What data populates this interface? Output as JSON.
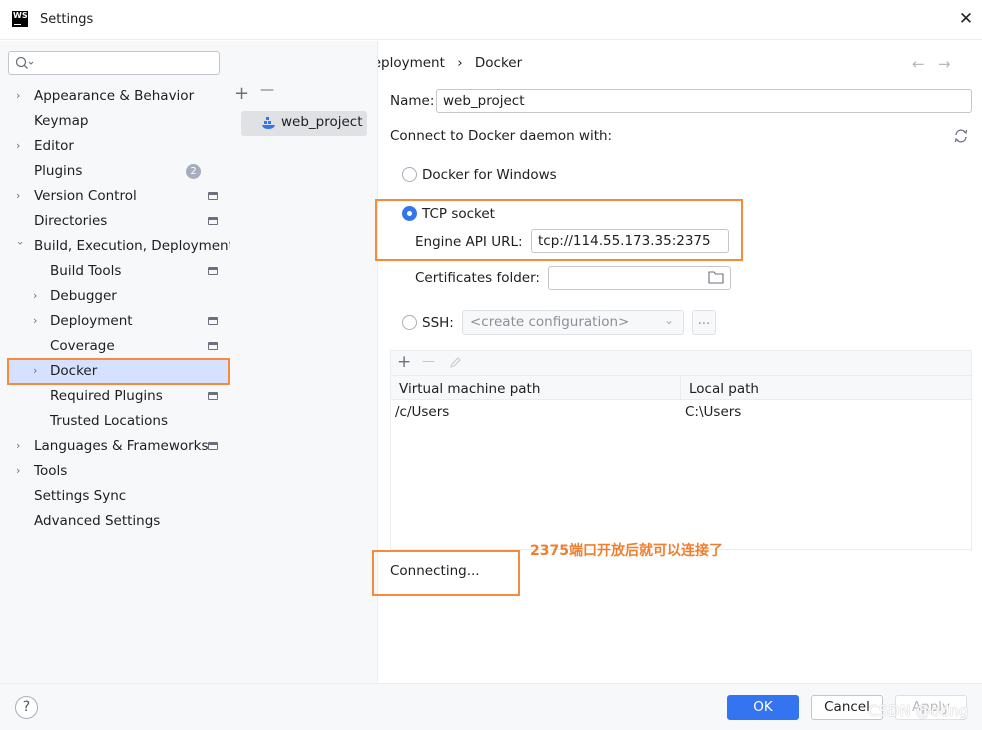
{
  "window": {
    "title": "Settings"
  },
  "search": {
    "placeholder": ""
  },
  "sidebar": {
    "items": [
      {
        "label": "Appearance & Behavior"
      },
      {
        "label": "Keymap"
      },
      {
        "label": "Editor"
      },
      {
        "label": "Plugins",
        "badge": "2"
      },
      {
        "label": "Version Control"
      },
      {
        "label": "Directories"
      },
      {
        "label": "Build, Execution, Deployment"
      },
      {
        "label": "Build Tools"
      },
      {
        "label": "Debugger"
      },
      {
        "label": "Deployment"
      },
      {
        "label": "Coverage"
      },
      {
        "label": "Docker"
      },
      {
        "label": "Required Plugins"
      },
      {
        "label": "Trusted Locations"
      },
      {
        "label": "Languages & Frameworks"
      },
      {
        "label": "Tools"
      },
      {
        "label": "Settings Sync"
      },
      {
        "label": "Advanced Settings"
      }
    ]
  },
  "breadcrumb": {
    "parent": "Build, Execution, Deployment",
    "separator": "›",
    "current": "Docker"
  },
  "nav": {
    "back": "←",
    "forward": "→"
  },
  "config_list": {
    "add": "+",
    "remove": "—",
    "items": [
      "web_project"
    ]
  },
  "form": {
    "name_label": "Name:",
    "name_value": "web_project",
    "connect_label": "Connect to Docker daemon with:",
    "docker_windows_label": "Docker for Windows",
    "tcp_label": "TCP socket",
    "engine_api_label": "Engine API URL:",
    "engine_api_value": "tcp://114.55.173.35:2375",
    "certs_label": "Certificates folder:",
    "certs_value": "",
    "ssh_label": "SSH:",
    "ssh_combo": "<create configuration>",
    "ssh_dots": "..."
  },
  "mappings": {
    "toolbar": {
      "add": "+",
      "remove": "—"
    },
    "headers": [
      "Virtual machine path",
      "Local path"
    ],
    "rows": [
      [
        "/c/Users",
        "C:\\Users"
      ]
    ]
  },
  "status": {
    "connecting": "Connecting..."
  },
  "annotation": "2375端口开放后就可以连接了",
  "buttons": {
    "help": "?",
    "ok": "OK",
    "cancel": "Cancel",
    "apply": "Apply"
  },
  "watermark": "CSDN @odng",
  "colors": {
    "accent": "#3574f0",
    "highlight_box": "#f58b3c",
    "selection": "#d5e1ff"
  }
}
